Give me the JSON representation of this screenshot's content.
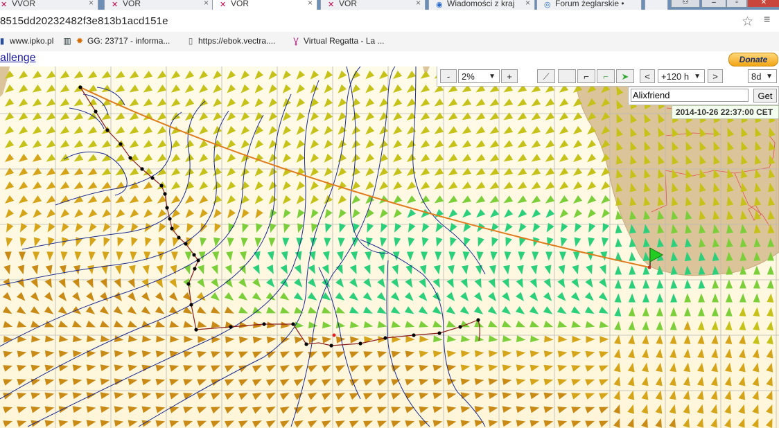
{
  "browser": {
    "tabs": [
      {
        "label": "VVOR",
        "icon": "vor-icon",
        "active": false
      },
      {
        "label": "VOR",
        "icon": "vor-icon",
        "active": false
      },
      {
        "label": "VOR",
        "icon": "vor-icon",
        "active": true
      },
      {
        "label": "VOR",
        "icon": "vor-icon",
        "active": false
      },
      {
        "label": "Wiadomości z kraj",
        "icon": "news-icon",
        "active": false
      },
      {
        "label": "Forum żeglarskie •",
        "icon": "forum-icon",
        "active": false
      }
    ],
    "url": "8515dd20232482f3e813b1acd151e",
    "bookmarks": [
      {
        "label": "www.ipko.pl",
        "icon": "bank-icon"
      },
      {
        "label": "GG: 23717 - informa...",
        "icon": "gg-icon"
      },
      {
        "label": "https://ebok.vectra....",
        "icon": "page-icon"
      },
      {
        "label": "Virtual Regatta - La ...",
        "icon": "regatta-icon"
      }
    ]
  },
  "page": {
    "challenge_link": "allenge",
    "donate_label": "Donate"
  },
  "controls": {
    "minus_label": "-",
    "opacity_value": "2%",
    "plus_label": "+",
    "prev_label": "<",
    "forecast_value": "+120 h",
    "next_label": ">",
    "range_value": "8d",
    "player_name": "Alixfriend",
    "get_label": "Get",
    "datetime": "2014-10-26 22:37:00 CET"
  },
  "colors": {
    "route_orange": "#e07b1c",
    "isochrone_line": "#1a2a8c",
    "land": "#dcc49a",
    "boat_flag": "#22cc22",
    "track_dark_red": "#8b1a1a"
  }
}
